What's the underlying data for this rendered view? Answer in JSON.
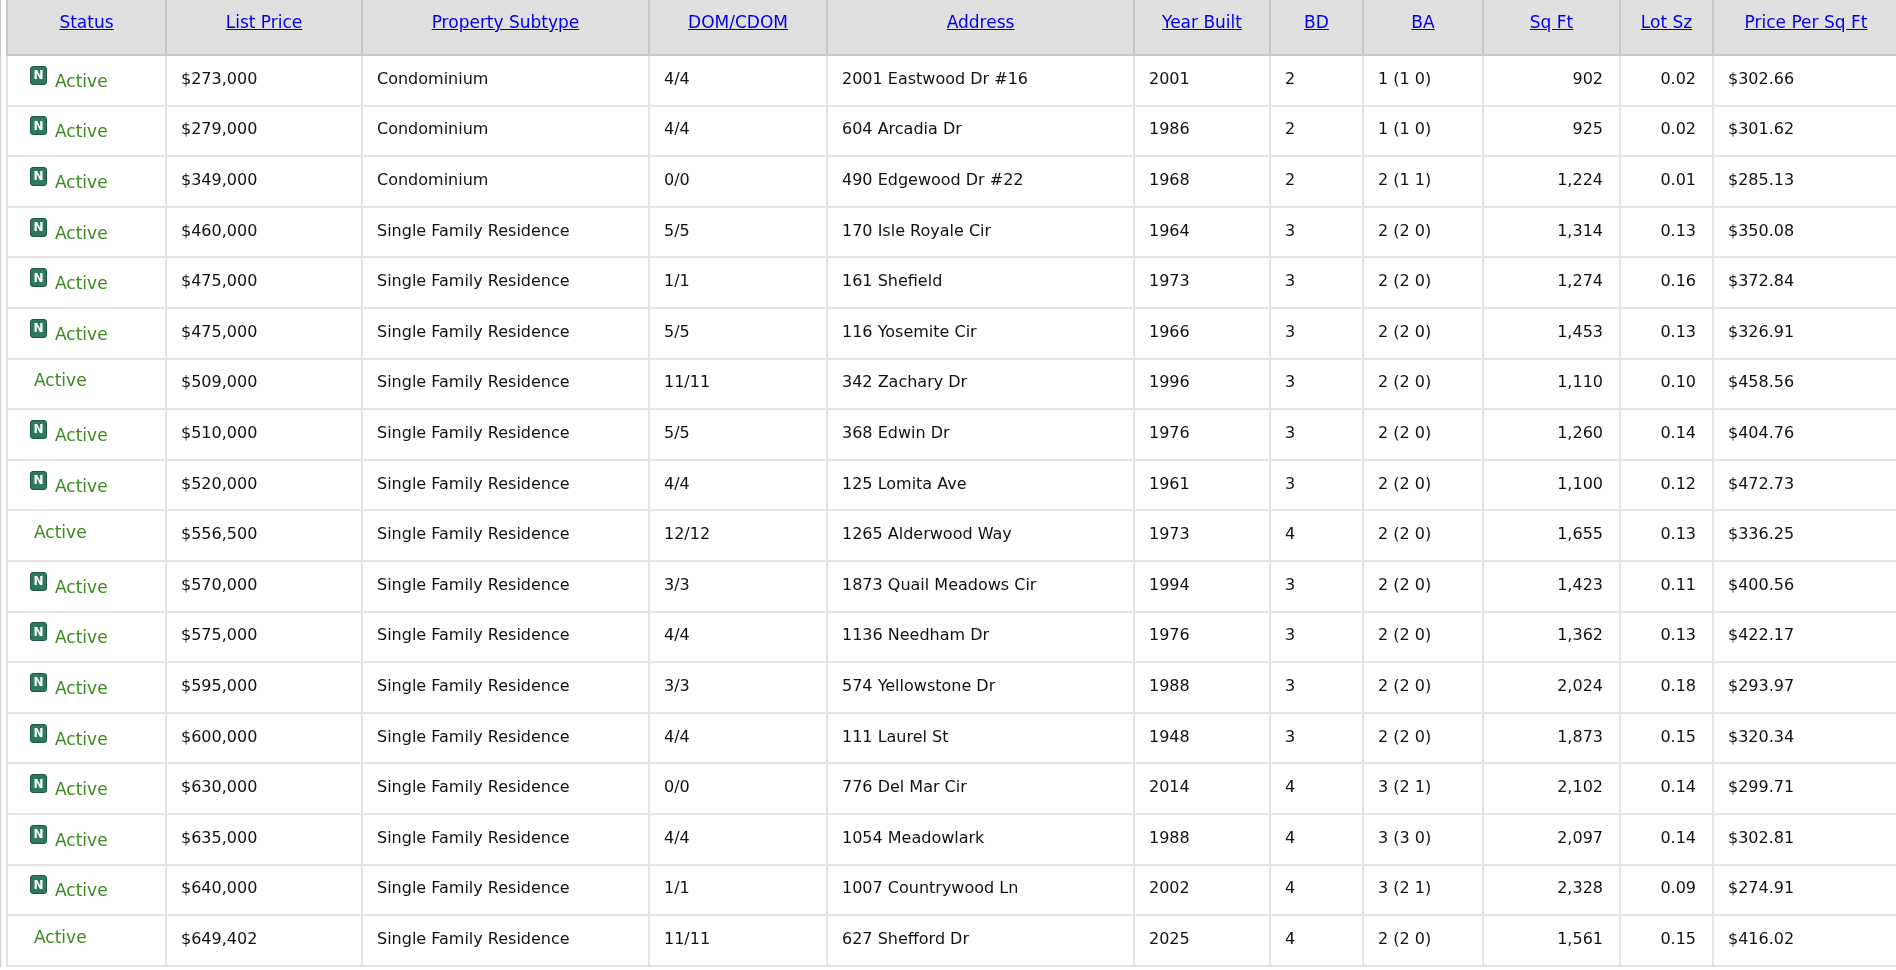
{
  "table": {
    "columns": [
      "Status",
      "List Price",
      "Property Subtype",
      "DOM/CDOM",
      "Address",
      "Year Built",
      "BD",
      "BA",
      "Sq Ft",
      "Lot Sz",
      "Price Per Sq Ft"
    ],
    "rows": [
      {
        "badge": "N",
        "cells": [
          "Active",
          "$273,000",
          "Condominium",
          "4/4",
          "2001 Eastwood Dr #16",
          "2001",
          "2",
          "1 (1 0)",
          "902",
          "0.02",
          "$302.66"
        ]
      },
      {
        "badge": "N",
        "cells": [
          "Active",
          "$279,000",
          "Condominium",
          "4/4",
          "604 Arcadia Dr",
          "1986",
          "2",
          "1 (1 0)",
          "925",
          "0.02",
          "$301.62"
        ]
      },
      {
        "badge": "N",
        "cells": [
          "Active",
          "$349,000",
          "Condominium",
          "0/0",
          "490 Edgewood Dr #22",
          "1968",
          "2",
          "2 (1 1)",
          "1,224",
          "0.01",
          "$285.13"
        ]
      },
      {
        "badge": "N",
        "cells": [
          "Active",
          "$460,000",
          "Single Family Residence",
          "5/5",
          "170 Isle Royale Cir",
          "1964",
          "3",
          "2 (2 0)",
          "1,314",
          "0.13",
          "$350.08"
        ]
      },
      {
        "badge": "N",
        "cells": [
          "Active",
          "$475,000",
          "Single Family Residence",
          "1/1",
          "161 Shefield",
          "1973",
          "3",
          "2 (2 0)",
          "1,274",
          "0.16",
          "$372.84"
        ]
      },
      {
        "badge": "N",
        "cells": [
          "Active",
          "$475,000",
          "Single Family Residence",
          "5/5",
          "116 Yosemite Cir",
          "1966",
          "3",
          "2 (2 0)",
          "1,453",
          "0.13",
          "$326.91"
        ]
      },
      {
        "cells": [
          "Active",
          "$509,000",
          "Single Family Residence",
          "11/11",
          "342 Zachary Dr",
          "1996",
          "3",
          "2 (2 0)",
          "1,110",
          "0.10",
          "$458.56"
        ]
      },
      {
        "badge": "N",
        "cells": [
          "Active",
          "$510,000",
          "Single Family Residence",
          "5/5",
          "368 Edwin Dr",
          "1976",
          "3",
          "2 (2 0)",
          "1,260",
          "0.14",
          "$404.76"
        ]
      },
      {
        "badge": "N",
        "cells": [
          "Active",
          "$520,000",
          "Single Family Residence",
          "4/4",
          "125 Lomita Ave",
          "1961",
          "3",
          "2 (2 0)",
          "1,100",
          "0.12",
          "$472.73"
        ]
      },
      {
        "cells": [
          "Active",
          "$556,500",
          "Single Family Residence",
          "12/12",
          "1265 Alderwood Way",
          "1973",
          "4",
          "2 (2 0)",
          "1,655",
          "0.13",
          "$336.25"
        ]
      },
      {
        "badge": "N",
        "cells": [
          "Active",
          "$570,000",
          "Single Family Residence",
          "3/3",
          "1873 Quail Meadows Cir",
          "1994",
          "3",
          "2 (2 0)",
          "1,423",
          "0.11",
          "$400.56"
        ]
      },
      {
        "badge": "N",
        "cells": [
          "Active",
          "$575,000",
          "Single Family Residence",
          "4/4",
          "1136 Needham Dr",
          "1976",
          "3",
          "2 (2 0)",
          "1,362",
          "0.13",
          "$422.17"
        ]
      },
      {
        "badge": "N",
        "cells": [
          "Active",
          "$595,000",
          "Single Family Residence",
          "3/3",
          "574 Yellowstone Dr",
          "1988",
          "3",
          "2 (2 0)",
          "2,024",
          "0.18",
          "$293.97"
        ]
      },
      {
        "badge": "N",
        "cells": [
          "Active",
          "$600,000",
          "Single Family Residence",
          "4/4",
          "111 Laurel St",
          "1948",
          "3",
          "2 (2 0)",
          "1,873",
          "0.15",
          "$320.34"
        ]
      },
      {
        "badge": "N",
        "cells": [
          "Active",
          "$630,000",
          "Single Family Residence",
          "0/0",
          "776 Del Mar Cir",
          "2014",
          "4",
          "3 (2 1)",
          "2,102",
          "0.14",
          "$299.71"
        ]
      },
      {
        "badge": "N",
        "cells": [
          "Active",
          "$635,000",
          "Single Family Residence",
          "4/4",
          "1054 Meadowlark",
          "1988",
          "4",
          "3 (3 0)",
          "2,097",
          "0.14",
          "$302.81"
        ]
      },
      {
        "badge": "N",
        "cells": [
          "Active",
          "$640,000",
          "Single Family Residence",
          "1/1",
          "1007 Countrywood Ln",
          "2002",
          "4",
          "3 (2 1)",
          "2,328",
          "0.09",
          "$274.91"
        ]
      },
      {
        "cells": [
          "Active",
          "$649,402",
          "Single Family Residence",
          "11/11",
          "627 Shefford Dr",
          "2025",
          "4",
          "2 (2 0)",
          "1,561",
          "0.15",
          "$416.02"
        ]
      }
    ]
  }
}
